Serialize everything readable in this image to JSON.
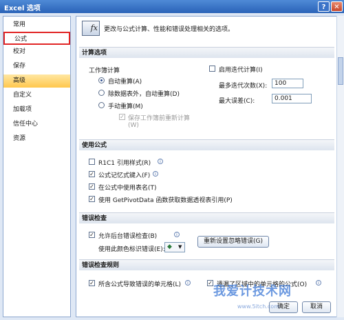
{
  "window": {
    "title": "Excel 选项",
    "help": "?",
    "close": "✕"
  },
  "sidebar": {
    "items": [
      {
        "label": "常用"
      },
      {
        "label": "公式"
      },
      {
        "label": "校对"
      },
      {
        "label": "保存"
      },
      {
        "label": "高级"
      },
      {
        "label": "自定义"
      },
      {
        "label": "加载项"
      },
      {
        "label": "信任中心"
      },
      {
        "label": "资源"
      }
    ]
  },
  "header": {
    "text": "更改与公式计算、性能和错误处理相关的选项。",
    "icon": "fx"
  },
  "calc": {
    "title": "计算选项",
    "workbook_label": "工作簿计算",
    "radio_auto": "自动重算(A)",
    "radio_auto_except": "除数据表外，自动重算(D)",
    "radio_manual": "手动重算(M)",
    "save_recalc": "保存工作簿前重新计算",
    "save_recalc_key": "(W)",
    "iter_label": "启用迭代计算(I)",
    "max_iter_label": "最多迭代次数(X):",
    "max_iter_value": "100",
    "max_change_label": "最大误差(C):",
    "max_change_value": "0.001"
  },
  "formulas": {
    "title": "使用公式",
    "r1c1": "R1C1 引用样式(R)",
    "autocomplete": "公式记忆式键入(F)",
    "table_names": "在公式中使用表名(T)",
    "getpivot": "使用 GetPivotData 函数获取数据透视表引用(P)"
  },
  "errors": {
    "title": "错误检查",
    "enable_bg": "允许后台错误检查(B)",
    "color_label": "使用此颜色标识错误(E):",
    "reset_button": "重新设置忽略错误(G)"
  },
  "rules": {
    "title": "错误检查规则",
    "rule1": "所含公式导致错误的单元格(L)",
    "rule2": "遗漏了区域中的单元格的公式(O)"
  },
  "footer": {
    "ok": "确定",
    "cancel": "取消"
  },
  "watermark": {
    "text": "我爱计技术网",
    "url": "www.5itch.com"
  },
  "colors": {
    "accent": "#ffc74d",
    "highlight": "#e12424",
    "title_bar": "#2a63b8"
  }
}
